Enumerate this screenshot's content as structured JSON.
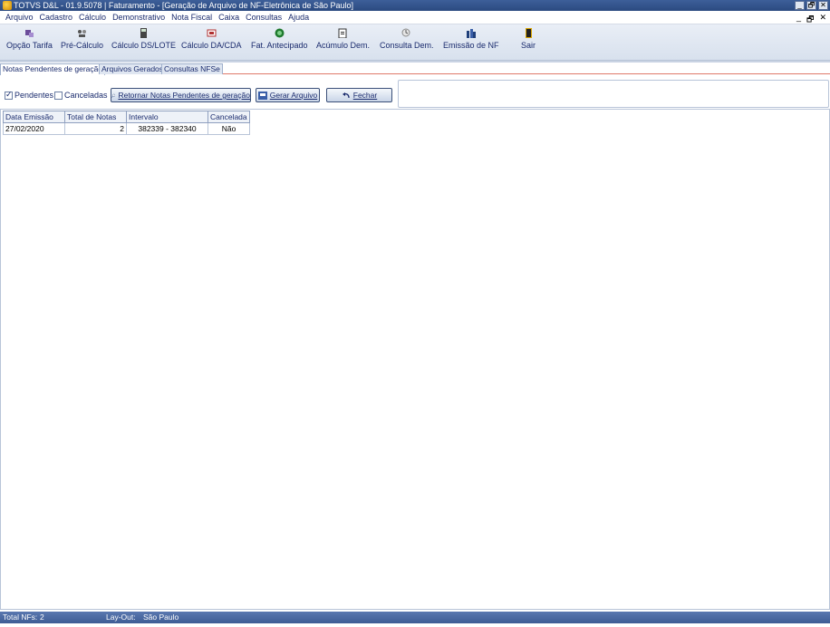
{
  "window": {
    "title": "TOTVS D&L - 01.9.5078 | Faturamento - [Geração de Arquivo de NF-Eletrônica de São Paulo]",
    "controls": [
      "_",
      "🗗",
      "✕"
    ]
  },
  "menubar": {
    "items": [
      "Arquivo",
      "Cadastro",
      "Cálculo",
      "Demonstrativo",
      "Nota Fiscal",
      "Caixa",
      "Consultas",
      "Ajuda"
    ],
    "mdi_controls": [
      "_",
      "🗗",
      "✕"
    ]
  },
  "toolbar": {
    "items": [
      {
        "label": "Opção Tarifa",
        "icon": "tariff-option-icon",
        "color": "#6b4c9a"
      },
      {
        "label": "Pré-Cálculo",
        "icon": "pre-calc-icon",
        "color": "#555555"
      },
      {
        "label": "Cálculo DS/LOTE",
        "icon": "calculator-icon",
        "color": "#444444"
      },
      {
        "label": "Cálculo DA/CDA",
        "icon": "calc-da-icon",
        "color": "#b03030"
      },
      {
        "label": "Fat. Antecipado",
        "icon": "advance-billing-icon",
        "color": "#1f7a2e"
      },
      {
        "label": "Acúmulo Dem.",
        "icon": "accumulate-icon",
        "color": "#333333"
      },
      {
        "label": "Consulta Dem.",
        "icon": "query-icon",
        "color": "#8a8a8a"
      },
      {
        "label": "Emissão de NF",
        "icon": "invoice-issue-icon",
        "color": "#1f3f7a"
      },
      {
        "label": "Sair",
        "icon": "exit-door-icon",
        "color": "#d9a400"
      }
    ]
  },
  "tabs": [
    {
      "label": "Notas Pendentes de geração",
      "active": true
    },
    {
      "label": "Arquivos Gerados",
      "active": false
    },
    {
      "label": "Consultas NFSe",
      "active": false
    }
  ],
  "filters": {
    "pendentes": {
      "label": "Pendentes",
      "checked": true
    },
    "canceladas": {
      "label": "Canceladas",
      "checked": false
    }
  },
  "buttons": {
    "retornar": "Retornar Notas Pendentes de geração",
    "gerar": "Gerar Arquivo",
    "fechar": "Fechar"
  },
  "grid": {
    "columns": [
      "Data Emissão",
      "Total de Notas",
      "Intervalo",
      "Cancelada"
    ],
    "rows": [
      [
        "27/02/2020",
        "2",
        "382339 - 382340",
        "Não"
      ]
    ]
  },
  "status": {
    "total_label": "Total NFs:",
    "total_value": "2",
    "layout_label": "Lay-Out:",
    "layout_value": "São Paulo"
  }
}
